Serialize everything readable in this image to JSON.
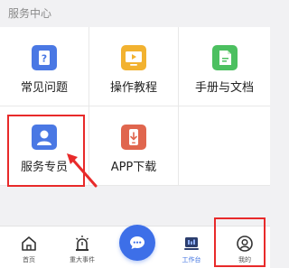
{
  "section": {
    "title": "服务中心"
  },
  "services": [
    {
      "label": "常见问题",
      "icon": "question-doc-icon",
      "color": "#4a78e4"
    },
    {
      "label": "操作教程",
      "icon": "video-tutorial-icon",
      "color": "#f2b230"
    },
    {
      "label": "手册与文档",
      "icon": "manual-document-icon",
      "color": "#4cc060"
    },
    {
      "label": "服务专员",
      "icon": "service-agent-icon",
      "color": "#4a78e4"
    },
    {
      "label": "APP下载",
      "icon": "app-download-icon",
      "color": "#e0664e"
    }
  ],
  "tabbar": {
    "items": [
      {
        "label": "首页",
        "icon": "home-icon"
      },
      {
        "label": "重大事件",
        "icon": "alert-event-icon"
      },
      {
        "label": "工作台",
        "icon": "workbench-icon",
        "active": true
      },
      {
        "label": "我的",
        "icon": "user-profile-icon"
      }
    ],
    "center_button_icon": "chat-bubble-icon"
  },
  "colors": {
    "accent": "#3d6fe8",
    "highlight": "#e82a2a"
  }
}
